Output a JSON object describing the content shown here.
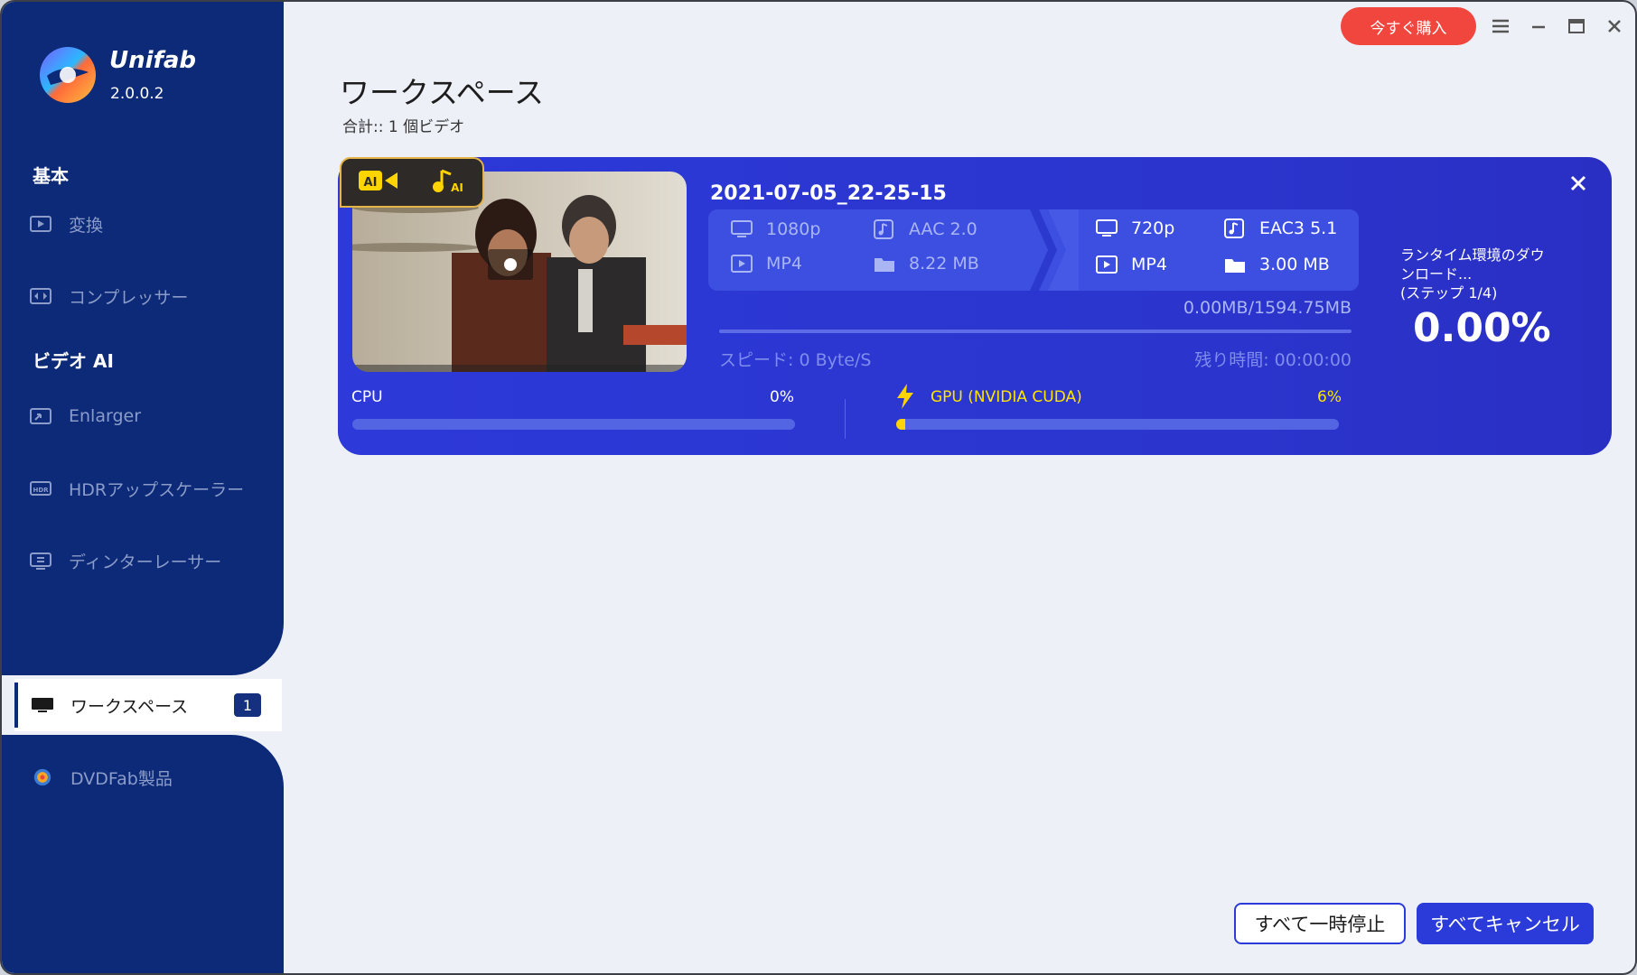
{
  "app": {
    "name": "Unifab",
    "version": "2.0.0.2"
  },
  "titlebar": {
    "buy_label": "今すぐ購入",
    "menu_icon": "hamburger-icon",
    "minimize_icon": "minimize-icon",
    "maximize_icon": "maximize-icon",
    "close_icon": "close-icon"
  },
  "sidebar": {
    "section_basic": "基本",
    "section_video_ai": "ビデオ AI",
    "items": [
      {
        "label": "変換",
        "icon": "play-box-icon"
      },
      {
        "label": "コンプレッサー",
        "icon": "compress-icon"
      },
      {
        "label": "Enlarger",
        "icon": "enlarge-icon"
      },
      {
        "label": "HDRアップスケーラー",
        "icon": "hdr-icon"
      },
      {
        "label": "ディンターレーサー",
        "icon": "deinterlace-icon"
      }
    ],
    "workspace": {
      "label": "ワークスペース",
      "badge": "1",
      "icon": "monitor-icon"
    },
    "dvdfab": {
      "label": "DVDFab製品",
      "icon": "dvdfab-logo-icon"
    }
  },
  "main": {
    "title": "ワークスペース",
    "total": "合計:: 1 個ビデオ"
  },
  "task": {
    "file_name": "2021-07-05_22-25-15",
    "source": {
      "resolution": "1080p",
      "audio": "AAC 2.0",
      "container": "MP4",
      "size": "8.22 MB"
    },
    "target": {
      "resolution": "720p",
      "audio": "EAC3 5.1",
      "container": "MP4",
      "size": "3.00 MB"
    },
    "size_progress": "0.00MB/1594.75MB",
    "speed": "スピード: 0 Byte/S",
    "remaining": "残り時間:  00:00:00",
    "status": "ランタイム環境のダウンロード...\n(ステップ 1/4)",
    "percent": "0.00%",
    "progress_fraction": 0.0,
    "cpu": {
      "label": "CPU",
      "value": "0%",
      "fraction": 0.0
    },
    "gpu": {
      "label": "GPU (NVIDIA CUDA)",
      "value": "6%",
      "fraction": 0.06
    },
    "tags": [
      "ai-video-icon",
      "ai-music-icon"
    ]
  },
  "footer": {
    "pause_all": "すべて一時停止",
    "cancel_all": "すべてキャンセル"
  },
  "colors": {
    "sidebar": "#0c2a78",
    "card": "#2d39d8",
    "accent_red": "#f0463e",
    "gpu_yellow": "#ffe400",
    "button_blue": "#2b3bd9"
  }
}
